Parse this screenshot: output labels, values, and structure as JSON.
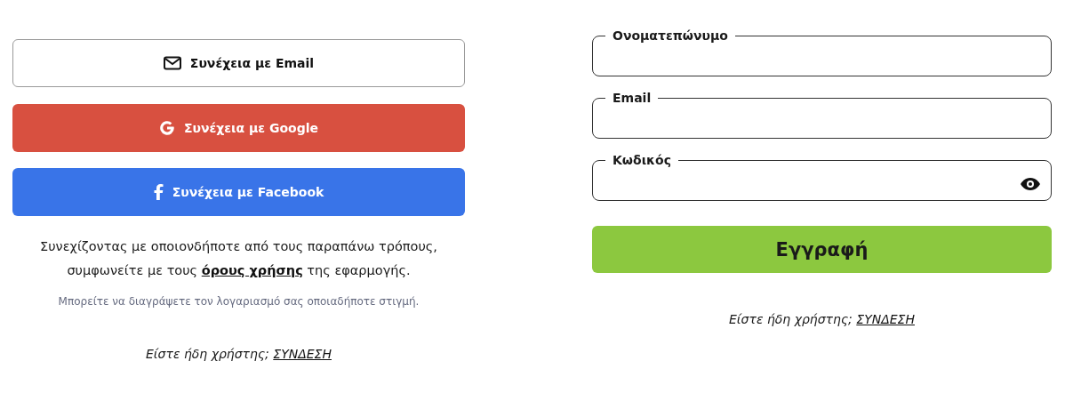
{
  "social_buttons": [
    {
      "kind": "email",
      "label": "Συνέχεια με Email"
    },
    {
      "kind": "google",
      "label": "Συνέχεια με Google"
    },
    {
      "kind": "facebook",
      "label": "Συνέχεια με Facebook"
    }
  ],
  "terms": {
    "before": "Συνεχίζοντας με οποιονδήποτε από τους παραπάνω τρόπους, συμφωνείτε με τους",
    "link": "όρους χρήσης",
    "after": "της εφαρμογής."
  },
  "delete_note": "Μπορείτε να διαγράψετε τον λογαριασμό σας οποιαδήποτε στιγμή.",
  "login_left": {
    "prompt": "Είστε ήδη χρήστης;",
    "link": "ΣΥΝΔΕΣΗ"
  },
  "form": {
    "fields": [
      {
        "kind": "text",
        "label": "Ονοματεπώνυμο"
      },
      {
        "kind": "email",
        "label": "Email"
      },
      {
        "kind": "password",
        "label": "Κωδικός"
      }
    ],
    "submit": "Εγγραφή"
  },
  "login_right": {
    "prompt": "Είστε ήδη χρήστης;",
    "link": "ΣΥΝΔΕΣΗ"
  }
}
